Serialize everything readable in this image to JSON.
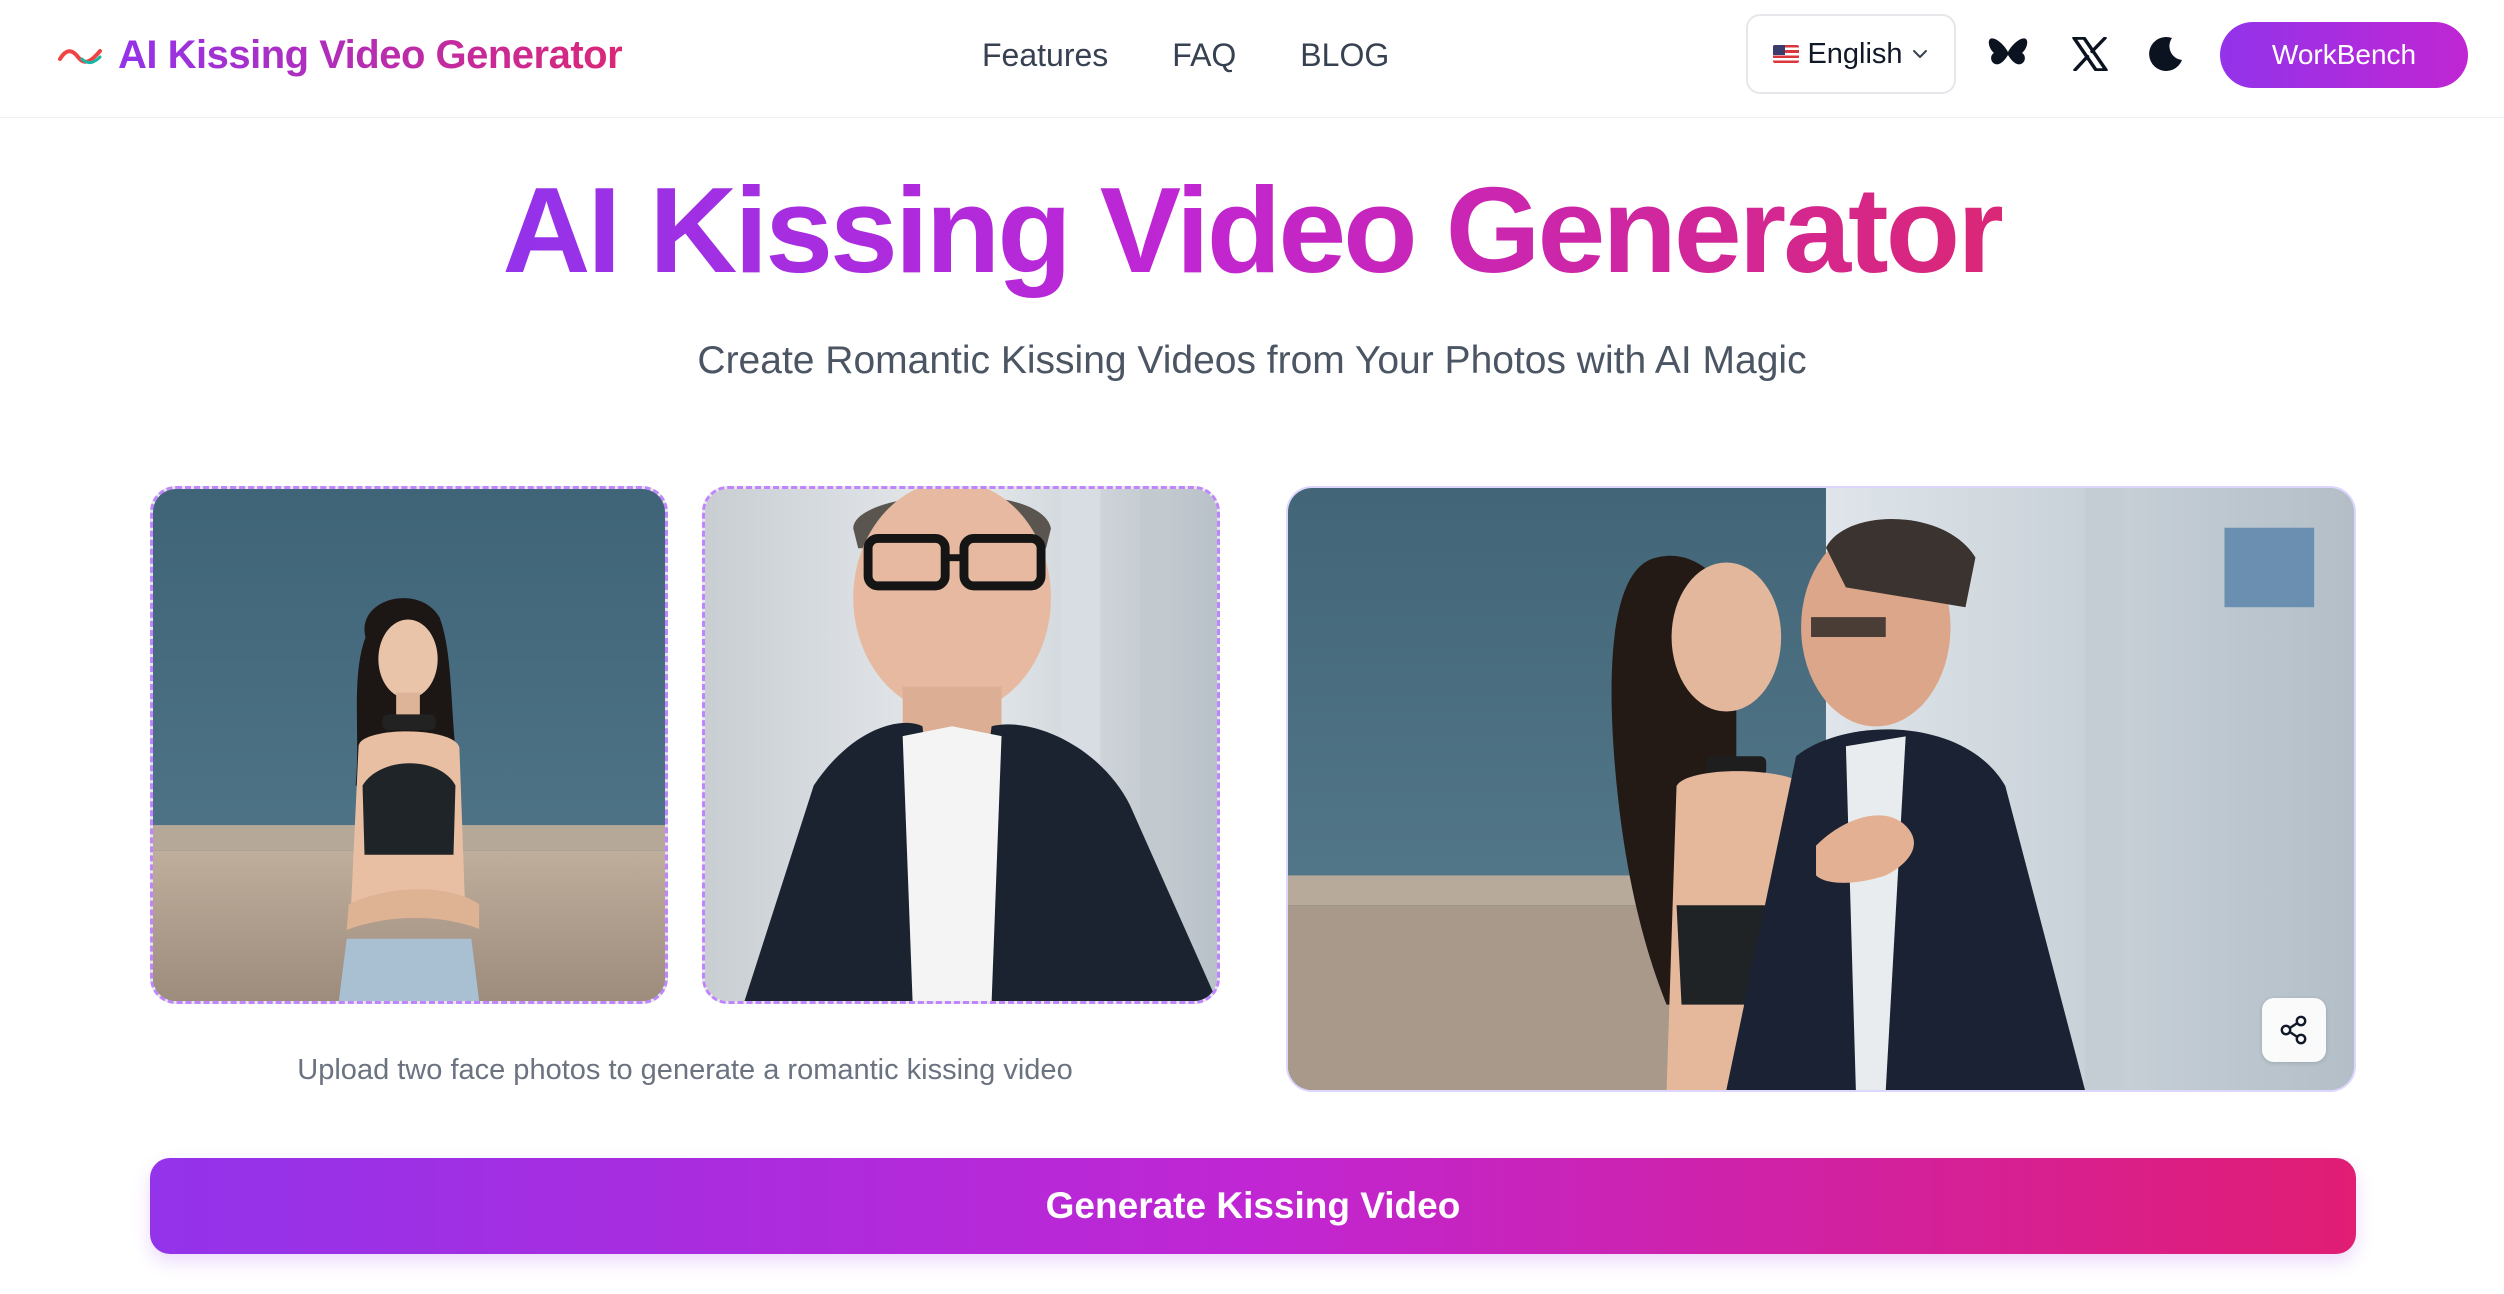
{
  "header": {
    "brand": "AI Kissing Video Generator",
    "nav": [
      "Features",
      "FAQ",
      "BLOG"
    ],
    "language": "English",
    "icons": [
      "bluesky-butterfly-icon",
      "x-icon",
      "moon-icon"
    ],
    "workbench_label": "WorkBench"
  },
  "hero": {
    "title": "AI Kissing Video Generator",
    "subtitle": "Create Romantic Kissing Videos from Your Photos with AI Magic"
  },
  "upload": {
    "hint": "Upload two face photos to generate a romantic kissing video",
    "photo_1": "woman-portrait-photo",
    "photo_2": "man-portrait-photo"
  },
  "result": {
    "preview": "kissing-video-preview",
    "share_icon": "share-icon"
  },
  "generate_label": "Generate Kissing Video",
  "colors": {
    "accent_purple": "#9333ea",
    "accent_pink": "#db2777",
    "dashed_border": "#c084fc",
    "text_muted": "#6b7280"
  }
}
